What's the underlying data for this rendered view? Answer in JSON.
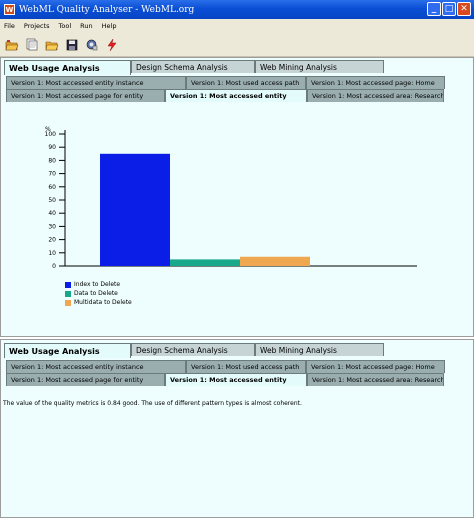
{
  "window": {
    "title": "WebML Quality Analyser - WebML.org",
    "minimize": "_",
    "maximize": "□",
    "close": "✕"
  },
  "menu": [
    "File",
    "Projects",
    "Tool",
    "Run",
    "Help"
  ],
  "toolbar": {
    "icons": [
      "open-folder-icon",
      "document-icon",
      "folder-icon",
      "save-icon",
      "settings-icon",
      "run-icon"
    ]
  },
  "main_tabs": [
    "Web Usage Analysis",
    "Design Schema Analysis",
    "Web Mining Analysis"
  ],
  "sub_tabs_top": [
    "Version 1: Most accessed entity instance",
    "Version 1: Most used access path",
    "Version 1: Most accessed page: Home"
  ],
  "sub_tabs_bottom": [
    "Version 1: Most accessed page for entity",
    "Version 1: Most accessed entity",
    "Version 1: Most accessed area: Research"
  ],
  "chart_data": {
    "type": "bar",
    "ylabel": "%",
    "ylim": [
      0,
      100
    ],
    "yticks": [
      0,
      10,
      20,
      30,
      40,
      50,
      60,
      70,
      80,
      90,
      100
    ],
    "series": [
      {
        "name": "Index to Delete",
        "value": 85,
        "color": "#0a1ee8"
      },
      {
        "name": "Data to Delete",
        "value": 5,
        "color": "#1aa88a"
      },
      {
        "name": "Multidata to Delete",
        "value": 7,
        "color": "#f0a850"
      }
    ]
  },
  "bottom_panel": {
    "message": "The value of the quality metrics is 0.84 good. The use of different pattern types is almost coherent."
  }
}
